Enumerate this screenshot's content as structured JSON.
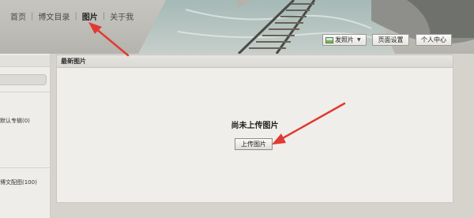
{
  "nav": {
    "items": [
      "首页",
      "博文目录",
      "图片",
      "关于我"
    ],
    "active_index": 2
  },
  "toolbar": {
    "post_photo": "发照片",
    "page_settings": "页面设置",
    "personal_center": "个人中心"
  },
  "sidebar": {
    "items": [
      {
        "label": "默认专辑",
        "count": "(0)"
      },
      {
        "label": "博文配图",
        "count": "(100)"
      }
    ]
  },
  "content": {
    "title": "最新图片",
    "empty_message": "尚未上传图片",
    "upload_button": "上传图片"
  },
  "colors": {
    "annotation_arrow": "#e03a33",
    "page_background": "#d6d3cd"
  }
}
